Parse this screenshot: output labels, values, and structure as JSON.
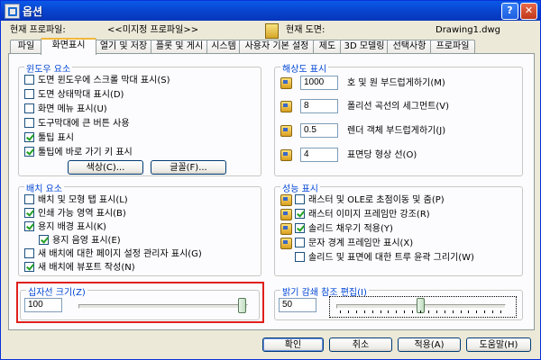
{
  "window": {
    "title": "옵션",
    "help_glyph": "?",
    "close_glyph": "✕"
  },
  "profile": {
    "current_profile_label": "현재 프로파일:",
    "current_profile_value": "<<미지정 프로파일>>",
    "current_drawing_label": "현재 도면:",
    "current_drawing_value": "Drawing1.dwg"
  },
  "tabs": [
    "파일",
    "화면표시",
    "열기 및 저장",
    "플롯 및 게시",
    "시스템",
    "사용자 기본 설정",
    "제도",
    "3D 모델링",
    "선택사항",
    "프로파일"
  ],
  "window_elements": {
    "title": "윈도우 요소",
    "checkboxes": [
      {
        "label": "도면 윈도우에 스크롤 막대 표시(S)",
        "checked": false
      },
      {
        "label": "도면 상태막대 표시(D)",
        "checked": false
      },
      {
        "label": "화면 메뉴 표시(U)",
        "checked": false
      },
      {
        "label": "도구막대에 큰 버튼 사용",
        "checked": false
      },
      {
        "label": "툴팁 표시",
        "checked": true
      },
      {
        "label": "툴팁에 바로 가기 키 표시",
        "checked": true
      }
    ],
    "colors_button": "색상(C)...",
    "fonts_button": "글꼴(F)..."
  },
  "resolution": {
    "title": "해상도 표시",
    "rows": [
      {
        "value": "1000",
        "label": "호 및 원 부드럽게하기(M)"
      },
      {
        "value": "8",
        "label": "폴리선 곡선의 세그먼트(V)"
      },
      {
        "value": "0.5",
        "label": "렌더 객체 부드럽게하기(J)"
      },
      {
        "value": "4",
        "label": "표면당 형상 선(O)"
      }
    ]
  },
  "layout_elements": {
    "title": "배치 요소",
    "checkboxes": [
      {
        "label": "배치 및 모형 탭 표시(L)",
        "checked": false
      },
      {
        "label": "인쇄 가능 영역 표시(B)",
        "checked": true
      },
      {
        "label": "용지 배경 표시(K)",
        "checked": true
      },
      {
        "label": "용지 음영 표시(E)",
        "checked": true
      },
      {
        "label": "새 배치에 대한 페이지 설정 관리자 표시(G)",
        "checked": false
      },
      {
        "label": "새 배치에 뷰포트 작성(N)",
        "checked": true
      }
    ]
  },
  "performance": {
    "title": "성능 표시",
    "checkboxes": [
      {
        "label": "래스터 및 OLE로 초점이동 및 줌(P)",
        "checked": false
      },
      {
        "label": "래스터 이미지 프레임만 강조(R)",
        "checked": true
      },
      {
        "label": "솔리드 채우기 적용(Y)",
        "checked": true
      },
      {
        "label": "문자 경계 프레임만 표시(X)",
        "checked": false
      },
      {
        "label": "솔리드 및 표면에 대한 트루 윤곽 그리기(W)",
        "checked": false
      }
    ]
  },
  "crosshair": {
    "title": "십자선 크기(Z)",
    "value": "100",
    "level_percent": 100
  },
  "xref_fade": {
    "title": "밝기 감쇄 참조 편집(I)",
    "value": "50",
    "level_percent": 50
  },
  "buttons": {
    "ok": "확인",
    "cancel": "취소",
    "apply": "적용(A)",
    "help": "도움말(H)"
  }
}
